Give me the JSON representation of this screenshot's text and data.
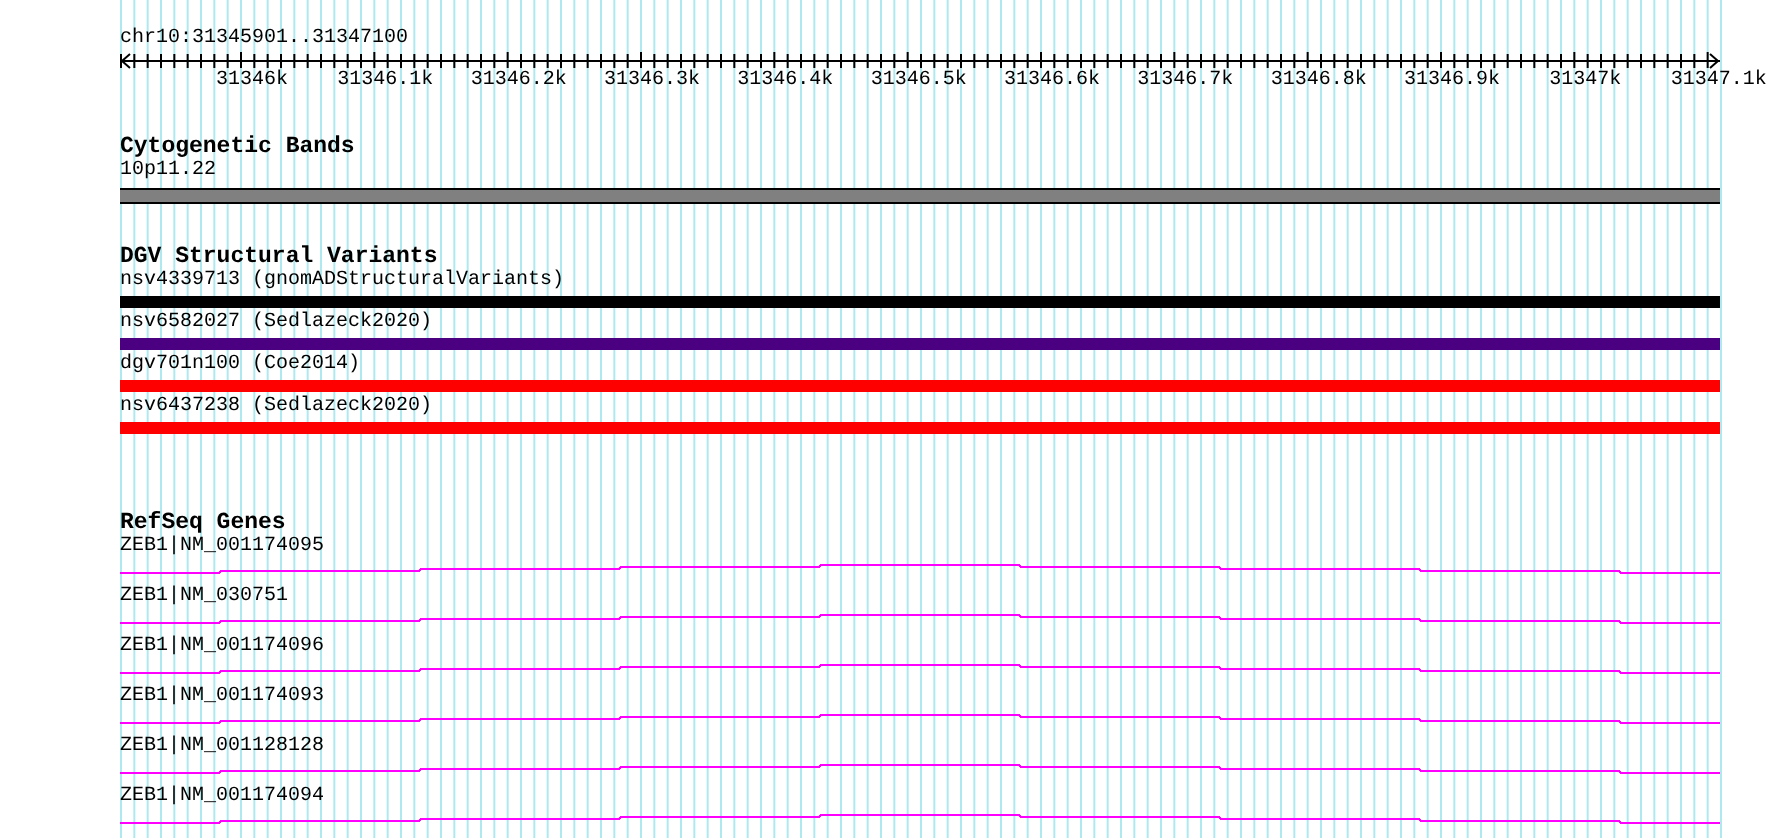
{
  "ruler": {
    "locus": "chr10:31345901..31347100",
    "ticks": [
      "31346k",
      "31346.1k",
      "31346.2k",
      "31346.3k",
      "31346.4k",
      "31346.5k",
      "31346.6k",
      "31346.7k",
      "31346.8k",
      "31346.9k",
      "31347k",
      "31347.1k"
    ]
  },
  "tracks": [
    {
      "title": "Cytogenetic Bands",
      "kind": "band",
      "features": [
        {
          "label": "10p11.22",
          "color": "#808080"
        }
      ]
    },
    {
      "title": "DGV Structural Variants",
      "kind": "variant",
      "features": [
        {
          "label": "nsv4339713 (gnomADStructuralVariants)",
          "color": "#000000"
        },
        {
          "label": "nsv6582027 (Sedlazeck2020)",
          "color": "#4b0082"
        },
        {
          "label": "dgv701n100 (Coe2014)",
          "color": "#ff0000"
        },
        {
          "label": "nsv6437238 (Sedlazeck2020)",
          "color": "#ff0000"
        }
      ]
    },
    {
      "title": "RefSeq Genes",
      "kind": "gene",
      "features": [
        {
          "label": "ZEB1|NM_001174095",
          "color": "#ff00ff"
        },
        {
          "label": "ZEB1|NM_030751",
          "color": "#ff00ff"
        },
        {
          "label": "ZEB1|NM_001174096",
          "color": "#ff00ff"
        },
        {
          "label": "ZEB1|NM_001174093",
          "color": "#ff00ff"
        },
        {
          "label": "ZEB1|NM_001128128",
          "color": "#ff00ff"
        },
        {
          "label": "ZEB1|NM_001174094",
          "color": "#ff00ff"
        }
      ]
    }
  ]
}
